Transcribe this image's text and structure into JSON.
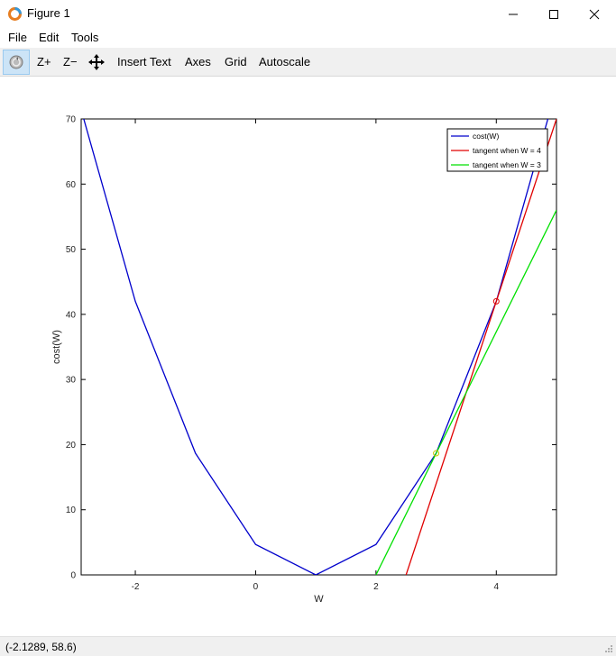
{
  "window": {
    "title": "Figure 1",
    "icon": "octave-logo-icon"
  },
  "menu": {
    "file": "File",
    "edit": "Edit",
    "tools": "Tools"
  },
  "toolbar": {
    "rotate_icon": "rotate-icon",
    "zoom_in": "Z+",
    "zoom_out": "Z−",
    "pan_icon": "pan-icon",
    "insert_text": "Insert Text",
    "axes": "Axes",
    "grid": "Grid",
    "autoscale": "Autoscale"
  },
  "status": {
    "coordinates": "(-2.1289, 58.6)"
  },
  "chart_data": {
    "type": "line",
    "title": "",
    "xlabel": "W",
    "ylabel": "cost(W)",
    "xlim": [
      -2.9,
      5
    ],
    "ylim": [
      0,
      70
    ],
    "xticks": [
      -2,
      0,
      2,
      4
    ],
    "yticks": [
      0,
      10,
      20,
      30,
      40,
      50,
      60,
      70
    ],
    "grid": false,
    "legend_position": "top-right",
    "series": [
      {
        "name": "cost(W)",
        "color": "#0000cc",
        "x": [
          -3,
          -2,
          -1,
          0,
          1,
          2,
          3,
          4,
          5
        ],
        "y": [
          74.67,
          42,
          18.67,
          4.67,
          0,
          4.67,
          18.67,
          42,
          74.67
        ]
      },
      {
        "name": "tangent when W = 4",
        "color": "#e00000",
        "x": [
          2.5,
          5
        ],
        "y": [
          0,
          70
        ]
      },
      {
        "name": "tangent when W = 3",
        "color": "#00e000",
        "x": [
          2,
          5
        ],
        "y": [
          0,
          56
        ]
      }
    ],
    "markers": [
      {
        "x": 4,
        "y": 42,
        "color": "#e00000"
      },
      {
        "x": 3,
        "y": 18.67,
        "color": "#c8c800"
      }
    ]
  }
}
